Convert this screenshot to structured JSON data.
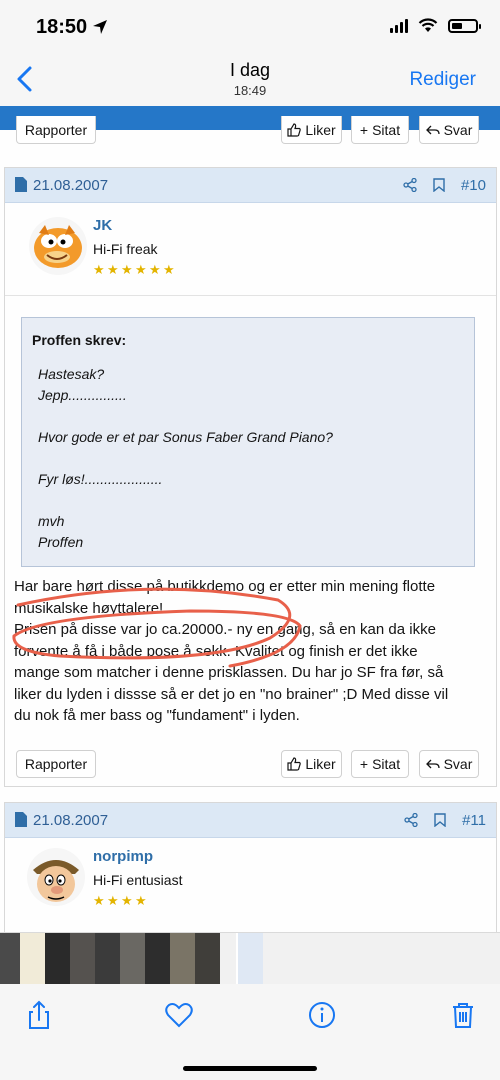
{
  "status_bar": {
    "time": "18:50"
  },
  "nav": {
    "title": "I dag",
    "subtitle": "18:49",
    "edit_label": "Rediger"
  },
  "top_actions": {
    "report": "Rapporter",
    "like": "Liker",
    "quote": "Sitat",
    "reply": "Svar"
  },
  "post10": {
    "date": "21.08.2007",
    "number": "#10",
    "user": {
      "name": "JK",
      "title": "Hi-Fi freak",
      "stars": 6
    },
    "quote": {
      "author": "Proffen skrev:",
      "lines": [
        "Hastesak?",
        "Jepp...............",
        "Hvor gode er et par Sonus Faber Grand Piano?",
        "Fyr løs!....................",
        "mvh",
        "Proffen"
      ]
    },
    "body": [
      "Har bare hørt disse på butikkdemo og er etter min mening flotte",
      "musikalske høyttalere!",
      "Prisen på disse var jo ca.20000.- ny en gang, så en kan da ikke",
      "forvente å få i både pose å sekk. Kvalitet og finish er det ikke",
      "mange som matcher i denne prisklassen. Du har jo SF fra før, så",
      "liker du lyden i dissse så er det jo en \"no brainer\" ;D Med disse vil",
      "du nok få mer bass og \"fundament\" i lyden."
    ],
    "actions": {
      "report": "Rapporter",
      "like": "Liker",
      "quote": "Sitat",
      "reply": "Svar"
    }
  },
  "post11": {
    "date": "21.08.2007",
    "number": "#11",
    "user": {
      "name": "norpimp",
      "title": "Hi-Fi entusiast",
      "stars": 4
    }
  },
  "colors": {
    "accent": "#1877f2",
    "forum_blue": "#2f6ea8",
    "annotation_red": "#e8604a"
  }
}
